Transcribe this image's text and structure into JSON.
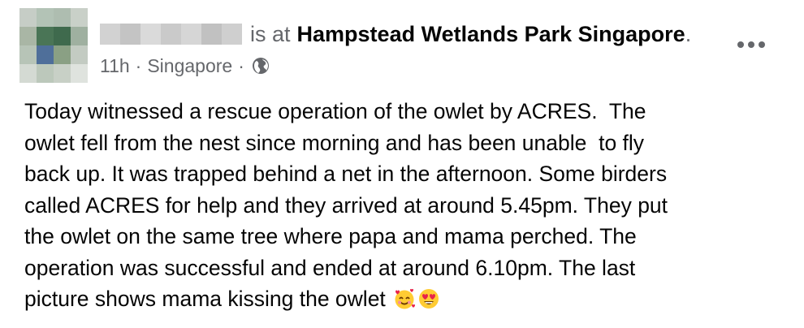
{
  "header": {
    "author_redacted": true,
    "is_at": "is at",
    "place": "Hampstead Wetlands Park Singapore",
    "period": ".",
    "more_icon": "more-horizontal-icon"
  },
  "meta": {
    "time": "11h",
    "separator": "·",
    "location": "Singapore",
    "separator2": "·",
    "audience_icon": "globe-icon"
  },
  "post": {
    "lines": [
      "Today witnessed a rescue operation of the owlet by ACRES.  The",
      "owlet fell from the nest since morning and has been unable  to fly",
      "back up. It was trapped behind a net in the afternoon. Some birders",
      "called ACRES for help and they arrived at around 5.45pm. They put",
      "the owlet on the same tree where papa and mama perched. The",
      "operation was successful and ended at around 6.10pm. The last",
      "picture shows mama kissing the owlet"
    ],
    "emojis": [
      "smiling-face-with-hearts-emoji",
      "heart-eyes-emoji"
    ]
  },
  "colors": {
    "secondary_text": "#65676b",
    "primary_text": "#050505",
    "emoji_yellow": "#ffcc33",
    "heart_red": "#e8234a"
  }
}
